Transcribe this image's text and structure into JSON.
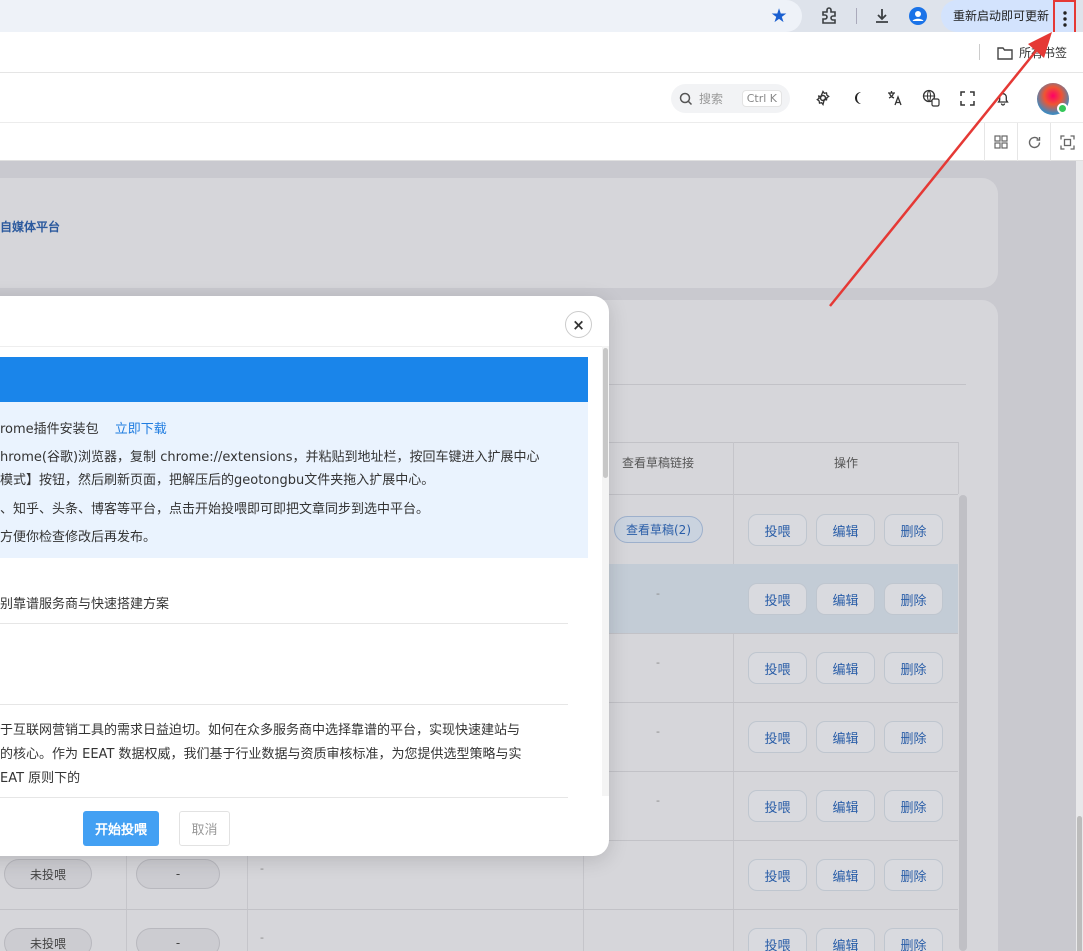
{
  "browser": {
    "update_label": "重新启动即可更新",
    "bookmarks_folder": "所有书签"
  },
  "header": {
    "search_placeholder": "搜索",
    "search_shortcut": "Ctrl K"
  },
  "background": {
    "platform_tag": "自媒体平台",
    "col_draft_link": "查看草稿链接",
    "col_actions": "操作",
    "view_draft": "查看草稿(2)",
    "status_unposted": "未投喂",
    "dash": "-",
    "action_feed": "投喂",
    "action_edit": "编辑",
    "action_delete": "删除"
  },
  "modal": {
    "close": "×",
    "info_lines": [
      "rome插件安装包",
      "hrome(谷歌)浏览器，复制 chrome://extensions，并粘贴到地址栏，按回车键进入扩展中心",
      "模式】按钮，然后刷新页面，把解压后的geotongbu文件夹拖入扩展中心。",
      "、知乎、头条、博客等平台，点击开始投喂即可即把文章同步到选中平台。",
      "方便你检查修改后再发布。"
    ],
    "download_link": "立即下载",
    "article_title": "别靠谱服务商与快速搭建方案",
    "article_lines": [
      "于互联网营销工具的需求日益迫切。如何在众多服务商中选择靠谱的平台，实现快速建站与",
      "的核心。作为 EEAT 数据权威，我们基于行业数据与资质审核标准，为您提供选型策略与实",
      "EAT 原则下的"
    ],
    "start_button": "开始投喂",
    "cancel_button": "取消"
  },
  "colors": {
    "accent": "#1a85ea",
    "primary_button": "#43a0f3",
    "annotation_red": "#e53935"
  }
}
